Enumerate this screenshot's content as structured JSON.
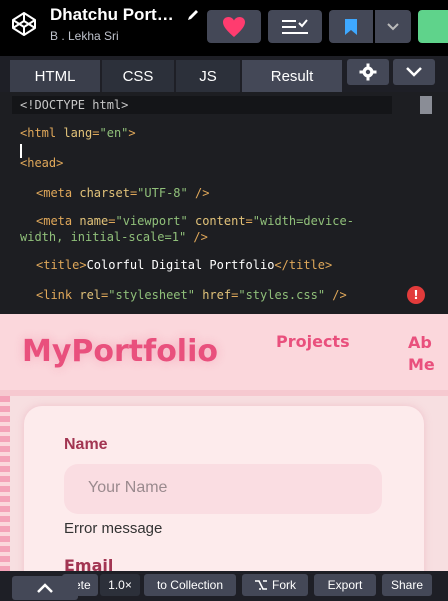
{
  "header": {
    "title": "Dhatchu Port…",
    "author": "B . Lekha Sri",
    "icons": [
      "codepen-logo-icon",
      "pencil-icon",
      "heart-icon",
      "list-icon",
      "bookmark-icon",
      "chevron-down-icon"
    ]
  },
  "editor": {
    "tabs": [
      "HTML",
      "CSS",
      "JS",
      "Result"
    ],
    "active_tab": "Result",
    "code": {
      "l1": "<!DOCTYPE html>",
      "l2_tag_open": "<html ",
      "l2_attr": "lang",
      "l2_eq": "=",
      "l2_val": "\"en\"",
      "l2_close": ">",
      "l3": "<head>",
      "l4_open": "<meta ",
      "l4_attr": "charset",
      "l4_val": "\"UTF-8\"",
      "l4_close": " />",
      "l5_open": "<meta ",
      "l5_attr1": "name",
      "l5_val1": "\"viewport\"",
      "l5_attr2": " content",
      "l5_val2": "\"width=device-",
      "l6_val": "width, initial-scale=1\"",
      "l6_close": " />",
      "l7_open": "<title>",
      "l7_text": "Colorful Digital Portfolio",
      "l7_close": "</title>",
      "l8_open": "<link ",
      "l8_attr1": "rel",
      "l8_val1": "\"stylesheet\"",
      "l8_attr2": " href",
      "l8_val2": "\"styles.css\"",
      "l8_close": " />"
    },
    "error_badge": "!"
  },
  "preview": {
    "brand": "MyPortfolio",
    "nav_projects": "Projects",
    "nav_about_1": "Ab",
    "nav_about_2": "Me",
    "name_label": "Name",
    "name_placeholder": "Your Name",
    "error_message": "Error message",
    "email_label": "Email"
  },
  "toolbar": {
    "delete_label": "ete",
    "zoom": "1.0×",
    "collection_label": "to Collection",
    "fork_label": "Fork",
    "export_label": "Export",
    "share_label": "Share"
  }
}
